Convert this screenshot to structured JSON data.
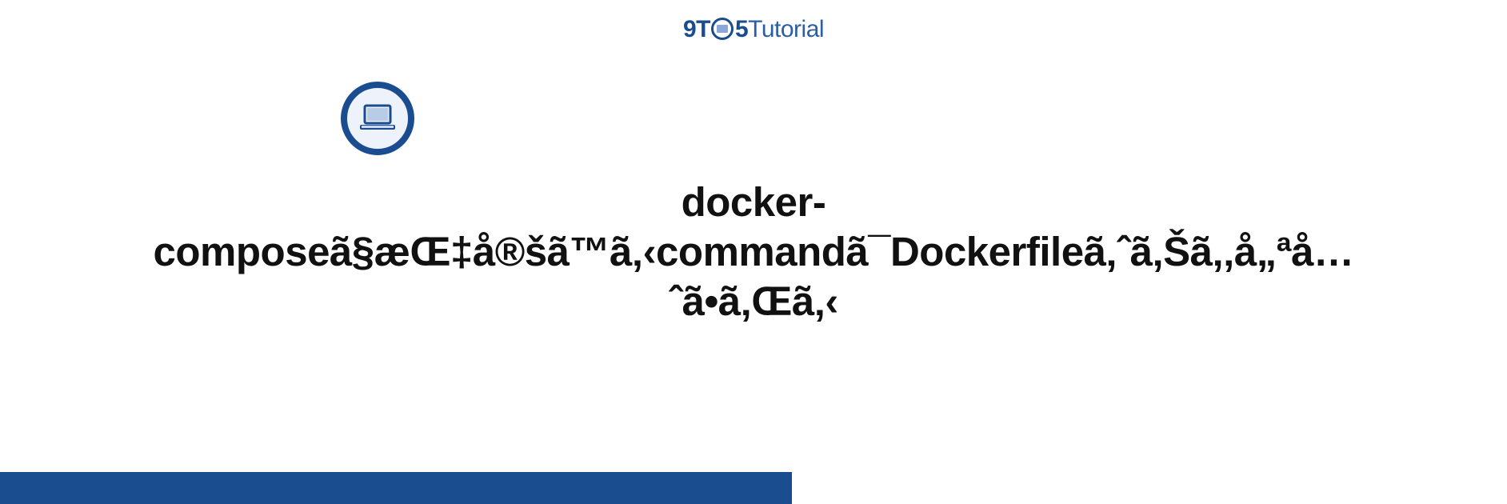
{
  "header": {
    "logo_9t": "9T",
    "logo_5": "5",
    "logo_tutorial": "Tutorial"
  },
  "article": {
    "title_line1": "docker-",
    "title_line2": "composeã§æŒ‡å®šã™ã‚‹commandã¯Dockerfileã‚ˆã‚Šã‚‚å„ªå…",
    "title_line3": "ˆã•ã‚Œã‚‹"
  },
  "colors": {
    "brand": "#1a4d8f",
    "accent_light": "#8aa8d8",
    "icon_bg": "#eef3fb"
  }
}
